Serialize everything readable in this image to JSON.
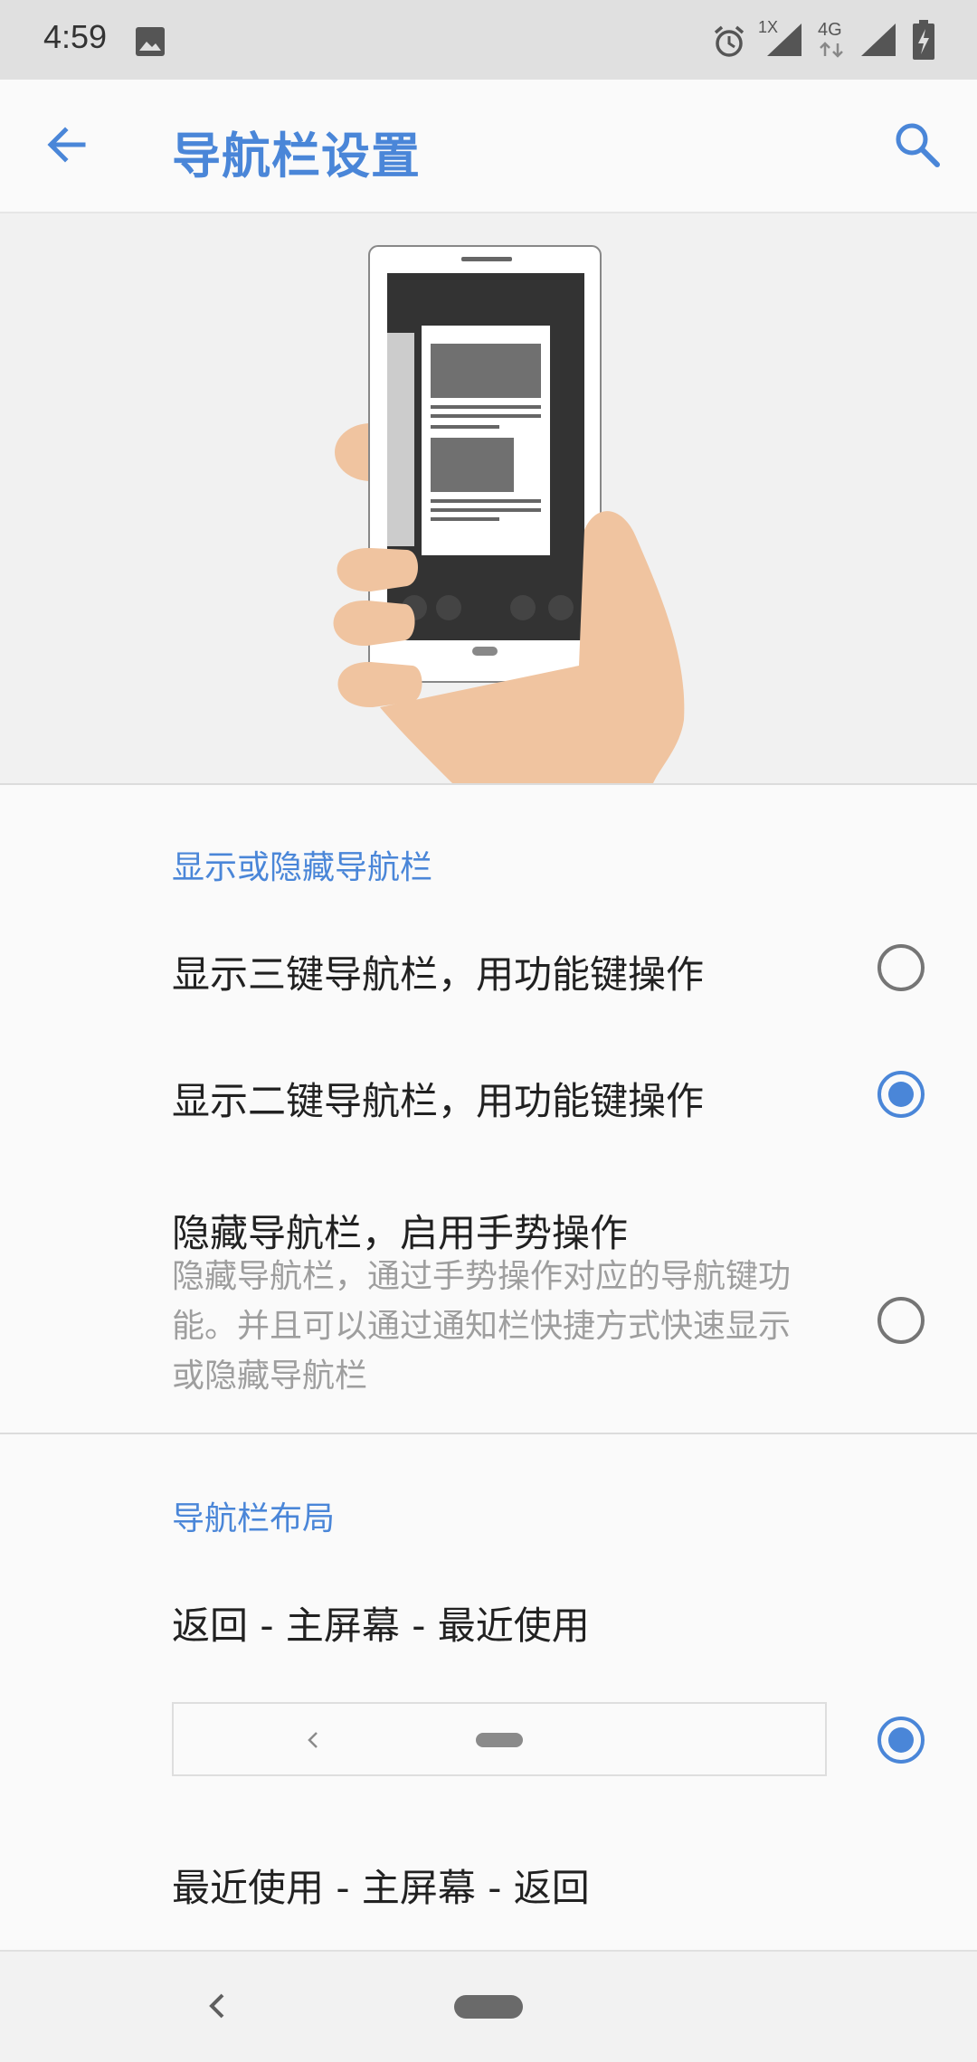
{
  "status_bar": {
    "time": "4:59",
    "signal_1_label": "1X",
    "signal_2_label": "4G",
    "icons": [
      "image-notification-icon",
      "alarm-icon",
      "signal-1x-icon",
      "signal-4g-icon",
      "battery-charging-icon"
    ]
  },
  "app_bar": {
    "title": "导航栏设置",
    "back_icon": "arrow-back-icon",
    "search_icon": "search-icon"
  },
  "section_show_hide": {
    "header": "显示或隐藏导航栏",
    "options": [
      {
        "title": "显示三键导航栏，用功能键操作",
        "selected": false
      },
      {
        "title": "显示二键导航栏，用功能键操作",
        "selected": true
      },
      {
        "title": "隐藏导航栏，启用手势操作",
        "summary_lines": [
          "隐藏导航栏，通过手势操作对应的导航键功",
          "能。并且可以通过通知栏快捷方式快速显示",
          "或隐藏导航栏"
        ],
        "selected": false
      }
    ]
  },
  "section_layout": {
    "header": "导航栏布局",
    "options": [
      {
        "title": "返回 - 主屏幕 - 最近使用",
        "selected": true
      },
      {
        "title": "最近使用 - 主屏幕 - 返回"
      }
    ]
  },
  "colors": {
    "accent": "#4a86d8",
    "status_bar_bg": "#e0e0e0",
    "page_bg": "#fafafa",
    "illustration_bg": "#f1f1f1",
    "skin": "#f0c4a0"
  }
}
